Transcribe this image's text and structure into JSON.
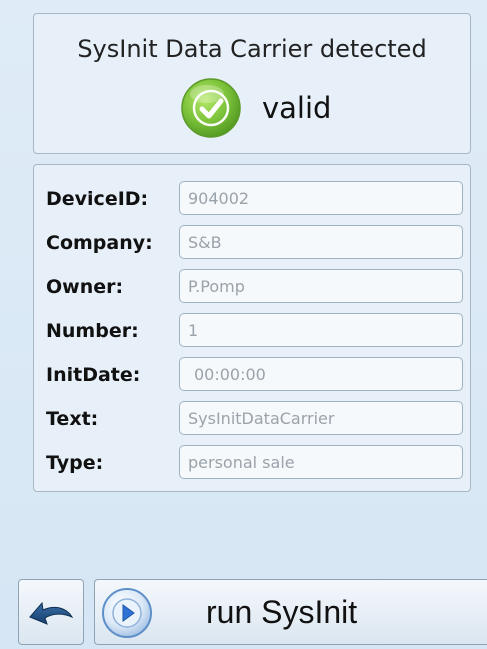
{
  "header": {
    "title": "SysInit Data Carrier detected",
    "status_icon": "check-icon",
    "status_text": "valid",
    "status_color": "#7cc23a"
  },
  "fields": [
    {
      "label": "DeviceID:",
      "value": "904002"
    },
    {
      "label": "Company:",
      "value": "S&B"
    },
    {
      "label": "Owner:",
      "value": "P.Pomp"
    },
    {
      "label": "Number:",
      "value": "1"
    },
    {
      "label": "InitDate:",
      "value": "00:00:00"
    },
    {
      "label": "Text:",
      "value": "SysInitDataCarrier"
    },
    {
      "label": "Type:",
      "value": "personal sale"
    }
  ],
  "footer": {
    "back_icon": "back-arrow-icon",
    "run_icon": "play-icon",
    "run_label": "run SysInit"
  },
  "colors": {
    "background": "#dbe9f5",
    "panel": "#e7f0f9",
    "input_text": "#9aa2aa",
    "accent_blue": "#2f72d6"
  }
}
